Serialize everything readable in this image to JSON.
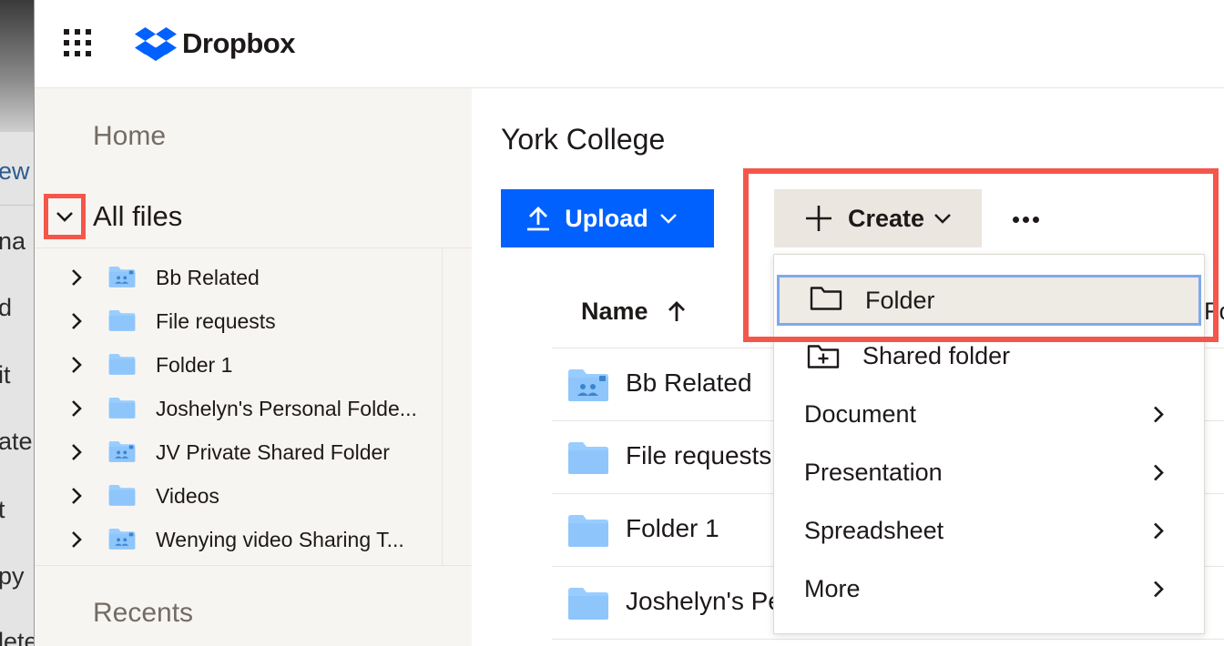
{
  "background_window": {
    "fragments": [
      "ew",
      "na",
      "d",
      "it",
      "ate:",
      "t",
      "py",
      "lete"
    ]
  },
  "header": {
    "apps_icon": "grid-icon",
    "logo_text": "Dropbox",
    "logo_icon": "dropbox-box-icon"
  },
  "sidebar": {
    "home_label": "Home",
    "all_files_label": "All files",
    "all_files_toggle_icon": "chevron-down-icon",
    "recents_label": "Recents",
    "tree": [
      {
        "label": "Bb Related",
        "icon": "shared-folder-icon"
      },
      {
        "label": "File requests",
        "icon": "folder-icon"
      },
      {
        "label": "Folder 1",
        "icon": "folder-icon"
      },
      {
        "label": "Joshelyn's Personal Folde...",
        "icon": "folder-icon"
      },
      {
        "label": "JV Private Shared Folder",
        "icon": "shared-folder-icon"
      },
      {
        "label": "Videos",
        "icon": "folder-icon"
      },
      {
        "label": "Wenying video Sharing T...",
        "icon": "shared-folder-icon"
      }
    ]
  },
  "main": {
    "title": "York College",
    "upload_label": "Upload",
    "create_label": "Create",
    "more_icon": "more-horizontal-icon",
    "column_name": "Name",
    "column_name_sort": "ascending",
    "column_partial": "Fo",
    "files": [
      {
        "name": "Bb Related",
        "icon": "shared-folder-icon"
      },
      {
        "name": "File requests",
        "icon": "folder-icon"
      },
      {
        "name": "Folder 1",
        "icon": "folder-icon"
      },
      {
        "name": "Joshelyn's Pe",
        "icon": "folder-icon"
      }
    ]
  },
  "create_menu": {
    "items": [
      {
        "label": "Folder",
        "icon": "folder-outline-icon",
        "selected": true
      },
      {
        "label": "Shared folder",
        "icon": "shared-folder-outline-icon"
      },
      {
        "label": "Document",
        "submenu": true
      },
      {
        "label": "Presentation",
        "submenu": true
      },
      {
        "label": "Spreadsheet",
        "submenu": true
      },
      {
        "label": "More",
        "submenu": true
      }
    ]
  },
  "colors": {
    "brand_blue": "#0061fe",
    "folder_blue": "#99cdff",
    "highlight_red": "#f5564a",
    "sidebar_bg": "#f7f5f2"
  }
}
